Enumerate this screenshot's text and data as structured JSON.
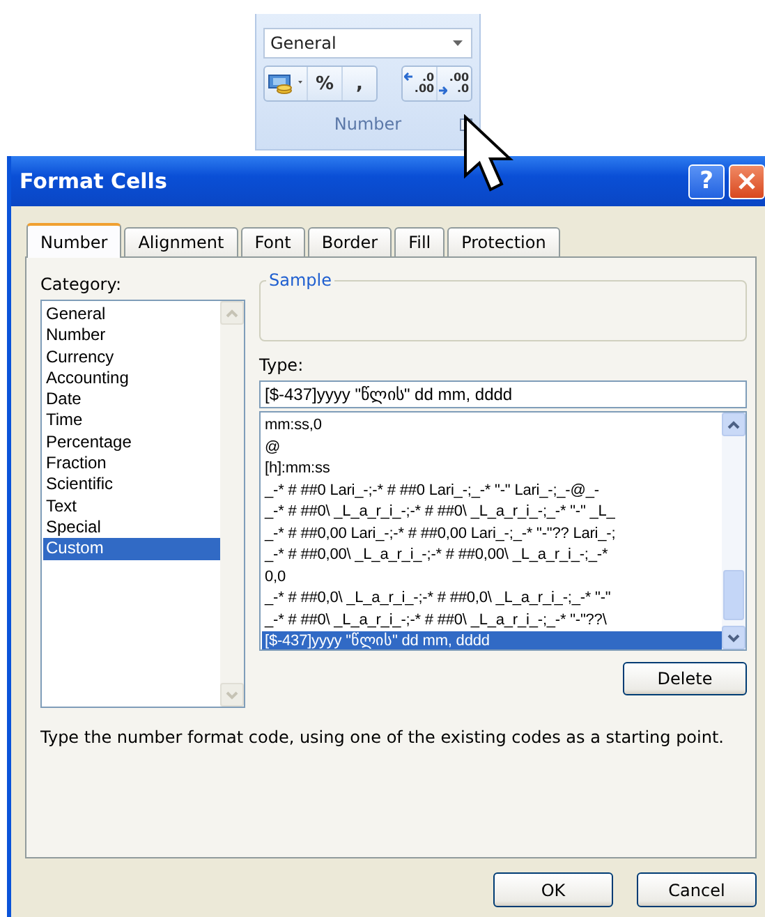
{
  "ribbon": {
    "number_format": "General",
    "buttons": [
      {
        "kind": "currency"
      },
      {
        "kind": "text",
        "label": "%"
      },
      {
        "kind": "text",
        "label": ","
      },
      {
        "kind": "increase_decimal",
        "top": ".0",
        "bottom": ".00"
      },
      {
        "kind": "decrease_decimal",
        "top": ".00",
        "bottom": ".0"
      }
    ],
    "group_label": "Number"
  },
  "dialog": {
    "title": "Format Cells",
    "help_button": "?",
    "tabs": [
      {
        "label": "Number",
        "selected": true
      },
      {
        "label": "Alignment",
        "selected": false
      },
      {
        "label": "Font",
        "selected": false
      },
      {
        "label": "Border",
        "selected": false
      },
      {
        "label": "Fill",
        "selected": false
      },
      {
        "label": "Protection",
        "selected": false
      }
    ],
    "category_label": "Category:",
    "categories": [
      {
        "label": "General",
        "selected": false
      },
      {
        "label": "Number",
        "selected": false
      },
      {
        "label": "Currency",
        "selected": false
      },
      {
        "label": "Accounting",
        "selected": false
      },
      {
        "label": "Date",
        "selected": false
      },
      {
        "label": "Time",
        "selected": false
      },
      {
        "label": "Percentage",
        "selected": false
      },
      {
        "label": "Fraction",
        "selected": false
      },
      {
        "label": "Scientific",
        "selected": false
      },
      {
        "label": "Text",
        "selected": false
      },
      {
        "label": "Special",
        "selected": false
      },
      {
        "label": "Custom",
        "selected": true
      }
    ],
    "sample_label": "Sample",
    "type_label": "Type:",
    "type_value": "[$-437]yyyy \"წლის\" dd mm, dddd",
    "type_list": [
      {
        "label": "mm:ss,0",
        "selected": false
      },
      {
        "label": "@",
        "selected": false
      },
      {
        "label": "[h]:mm:ss",
        "selected": false
      },
      {
        "label": "_-* # ##0 Lari_-;-* # ##0 Lari_-;_-* \"-\" Lari_-;_-@_-",
        "selected": false
      },
      {
        "label": "_-* # ##0\\ _L_a_r_i_-;-* # ##0\\ _L_a_r_i_-;_-* \"-\" _L_",
        "selected": false
      },
      {
        "label": "_-* # ##0,00 Lari_-;-* # ##0,00 Lari_-;_-* \"-\"?? Lari_-;",
        "selected": false
      },
      {
        "label": "_-* # ##0,00\\ _L_a_r_i_-;-* # ##0,00\\ _L_a_r_i_-;_-*",
        "selected": false
      },
      {
        "label": "0,0",
        "selected": false
      },
      {
        "label": "_-* # ##0,0\\ _L_a_r_i_-;-* # ##0,0\\ _L_a_r_i_-;_-* \"-\"",
        "selected": false
      },
      {
        "label": "_-* # ##0\\ _L_a_r_i_-;-* # ##0\\ _L_a_r_i_-;_-* \"-\"??\\",
        "selected": false
      },
      {
        "label": "[$-437]yyyy \"წლის\" dd mm, dddd",
        "selected": true
      }
    ],
    "delete_button": "Delete",
    "hint": "Type the number format code, using one of the existing codes as a starting point.",
    "buttons": [
      "OK",
      "Cancel"
    ]
  }
}
